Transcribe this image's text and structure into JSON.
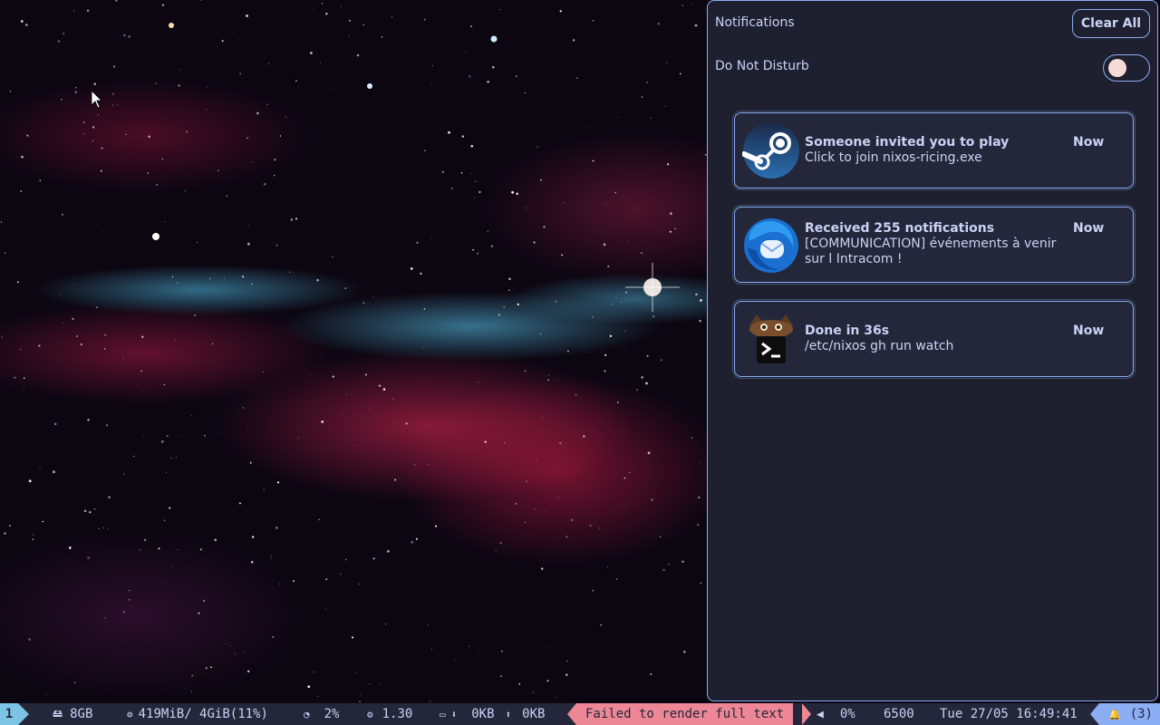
{
  "panel": {
    "title": "Notifications",
    "clear_all_label": "Clear All",
    "dnd_label": "Do Not Disturb",
    "dnd_enabled": false
  },
  "notifications": [
    {
      "app_icon": "steam-icon",
      "summary": "Someone invited you to play",
      "body": "Click to join nixos-ricing.exe",
      "time": "Now"
    },
    {
      "app_icon": "thunderbird-icon",
      "summary": "Received 255 notifications",
      "body": "[COMMUNICATION] événements à venir sur l Intracom !",
      "time": "Now"
    },
    {
      "app_icon": "terminal-cat-icon",
      "summary": "Done in 36s",
      "body": "/etc/nixos gh run watch",
      "time": "Now"
    }
  ],
  "bar": {
    "workspace": "1",
    "disk": "8GB",
    "memory": "419MiB/ 4GiB(11%)",
    "cpu": "2%",
    "load": "1.30",
    "net_down": "0KB",
    "net_up": "0KB",
    "warning": "Failed to render full text",
    "volume": "0%",
    "color_temp": "6500",
    "clock": "Tue 27/05 16:49:41",
    "notification_count": "(3)"
  },
  "colors": {
    "panel_bg": "#1e2030",
    "card_bg": "#24273a",
    "accent": "#8aadf4",
    "text": "#cad3f5",
    "warning": "#ed8796",
    "workspace": "#7dc4e4"
  }
}
